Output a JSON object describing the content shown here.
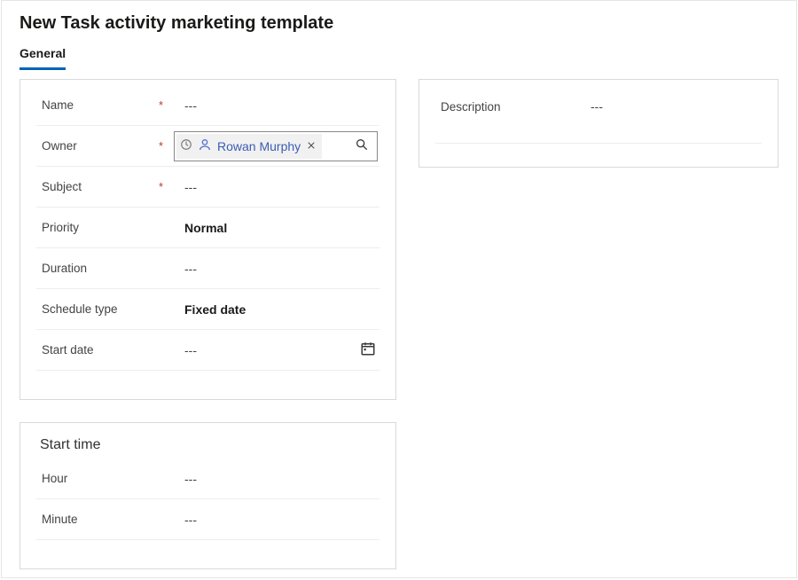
{
  "header": {
    "title": "New Task activity marketing template"
  },
  "tabs": {
    "general": "General"
  },
  "fields": {
    "name": {
      "label": "Name",
      "required": true,
      "value": "---"
    },
    "owner": {
      "label": "Owner",
      "required": true,
      "chip": "Rowan Murphy"
    },
    "subject": {
      "label": "Subject",
      "required": true,
      "value": "---"
    },
    "priority": {
      "label": "Priority",
      "required": false,
      "value": "Normal"
    },
    "duration": {
      "label": "Duration",
      "required": false,
      "value": "---"
    },
    "schedule_type": {
      "label": "Schedule type",
      "required": false,
      "value": "Fixed date"
    },
    "start_date": {
      "label": "Start date",
      "required": false,
      "value": "---"
    }
  },
  "start_time": {
    "title": "Start time",
    "hour": {
      "label": "Hour",
      "value": "---"
    },
    "minute": {
      "label": "Minute",
      "value": "---"
    }
  },
  "description": {
    "label": "Description",
    "value": "---"
  },
  "req_marker": "*"
}
